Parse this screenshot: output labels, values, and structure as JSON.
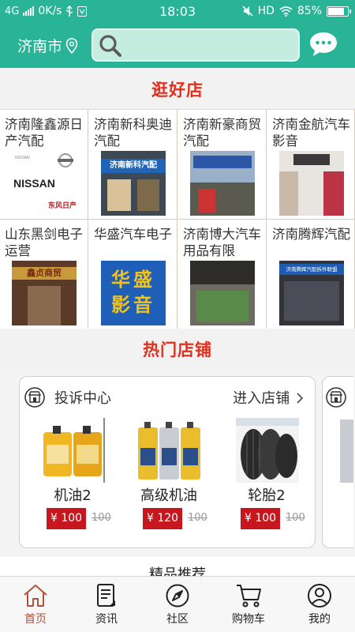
{
  "status_bar": {
    "network": "4G",
    "speed": "0K/s",
    "time": "18:03",
    "hd": "HD",
    "battery": "85%",
    "battery_level": 0.85
  },
  "header": {
    "city": "济南市",
    "location_icon": "location-pin-icon",
    "search_icon": "search-icon",
    "chat_icon": "chat-bubble-icon",
    "bg_color": "#29b497"
  },
  "section_good_stores": {
    "title": "逛好店"
  },
  "stores": [
    {
      "name": "济南隆鑫源日产汽配",
      "thumb_text": "NISSAN",
      "thumb_sub": "东风日产"
    },
    {
      "name": "济南新科奥迪汽配",
      "thumb_text": "济南新科汽配"
    },
    {
      "name": "济南新豪商贸汽配",
      "thumb_text": ""
    },
    {
      "name": "济南金航汽车影音",
      "thumb_text": ""
    },
    {
      "name": "山东黑剑电子运营",
      "thumb_text": "鑫贞商贸"
    },
    {
      "name": "华盛汽车电子",
      "thumb_text": "华盛影音"
    },
    {
      "name": "济南博大汽车用品有限",
      "thumb_text": ""
    },
    {
      "name": "济南腾辉汽配",
      "thumb_text": "济南腾辉汽配拆件联盟"
    }
  ],
  "section_hot_stores": {
    "title": "热门店铺"
  },
  "hot_store": {
    "name": "投诉中心",
    "enter_label": "进入店铺",
    "store_icon": "store-icon",
    "products": [
      {
        "name": "机油2",
        "price": "¥ 100",
        "old_price": "100"
      },
      {
        "name": "高级机油",
        "price": "¥ 120",
        "old_price": "100"
      },
      {
        "name": "轮胎2",
        "price": "¥ 100",
        "old_price": "100"
      }
    ]
  },
  "section_recommend": {
    "title": "精品推荐"
  },
  "tabbar": {
    "active": "首页",
    "active_color": "#b0533a",
    "items": [
      {
        "label": "首页",
        "icon": "home-icon"
      },
      {
        "label": "资讯",
        "icon": "news-icon"
      },
      {
        "label": "社区",
        "icon": "compass-icon"
      },
      {
        "label": "购物车",
        "icon": "cart-icon"
      },
      {
        "label": "我的",
        "icon": "user-icon"
      }
    ]
  }
}
